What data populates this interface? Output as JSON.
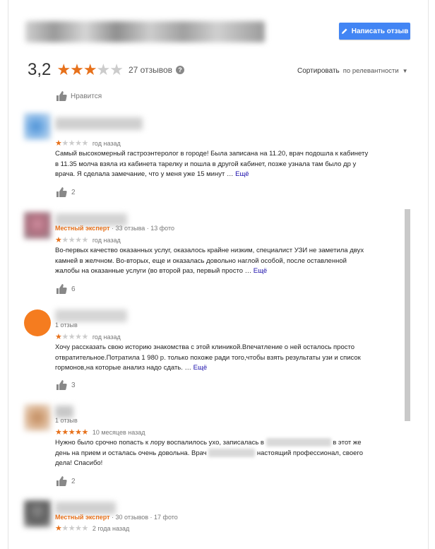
{
  "header": {
    "write_review_label": "Написать отзыв"
  },
  "summary": {
    "rating": "3,2",
    "stars_filled": 3,
    "stars_total": 5,
    "reviews_count": "27 отзывов",
    "sort_label": "Сортировать",
    "sort_value": "по релевантности"
  },
  "top_like": {
    "label": "Нравится"
  },
  "reviews": [
    {
      "meta": "",
      "stars": "★☆☆☆☆",
      "ago": "год назад",
      "text": "Самый высокомерный гастроэнтеролог в городе! Была записана на 11.20, врач подошла  к кабинету в 11.35 молча взяла из кабинета тарелку и пошла в другой кабинет, позже узнала там было др у врача. Я сделала замечание, что у меня уже 15 минут …",
      "more": "Ещё",
      "likes": "2"
    },
    {
      "meta_expert": "Местный эксперт",
      "meta": " · 33 отзыва · 13 фото",
      "stars": "★☆☆☆☆",
      "ago": "год назад",
      "text": "Во-первых качество оказанных услуг, оказалось крайне низким, специалист УЗИ не заметила двух камней в желчном. Во-вторых,  еще и оказалась довольно наглой особой, после оставленной жалобы на оказанные услуги (во второй раз, первый просто …",
      "more": "Ещё",
      "likes": "6"
    },
    {
      "meta": "1 отзыв",
      "stars": "★☆☆☆☆",
      "ago": "год назад",
      "text": "Хочу рассказать свою историю знакомства с этой клиникой.Впечатление о ней осталось просто отвратительное.Потратила 1 980 р. только похоже ради того,чтобы взять результаты узи и список гормонов,на которые анализ надо сдать. …",
      "more": "Ещё",
      "likes": "3"
    },
    {
      "meta": "1 отзыв",
      "stars": "★★★★★",
      "ago": "10 месяцев назад",
      "text_a": "Нужно было срочно попасть к лору воспалилось ухо, записалась в",
      "text_b": "в этот же день на прием и осталась очень довольна. Врач",
      "text_c": "настоящий профессионал,  своего дела! Спасибо!",
      "likes": "2"
    },
    {
      "meta_expert": "Местный эксперт",
      "meta": " · 30 отзывов · 17 фото",
      "stars": "★☆☆☆☆",
      "ago": "2 года назад"
    }
  ],
  "colors": {
    "accent": "#4285f4",
    "star": "#e7711b",
    "expert": "#e7711b",
    "link": "#1a0dab"
  },
  "icons": [
    "pencil-icon",
    "info-icon",
    "thumbs-up-icon",
    "caret-down-icon"
  ]
}
